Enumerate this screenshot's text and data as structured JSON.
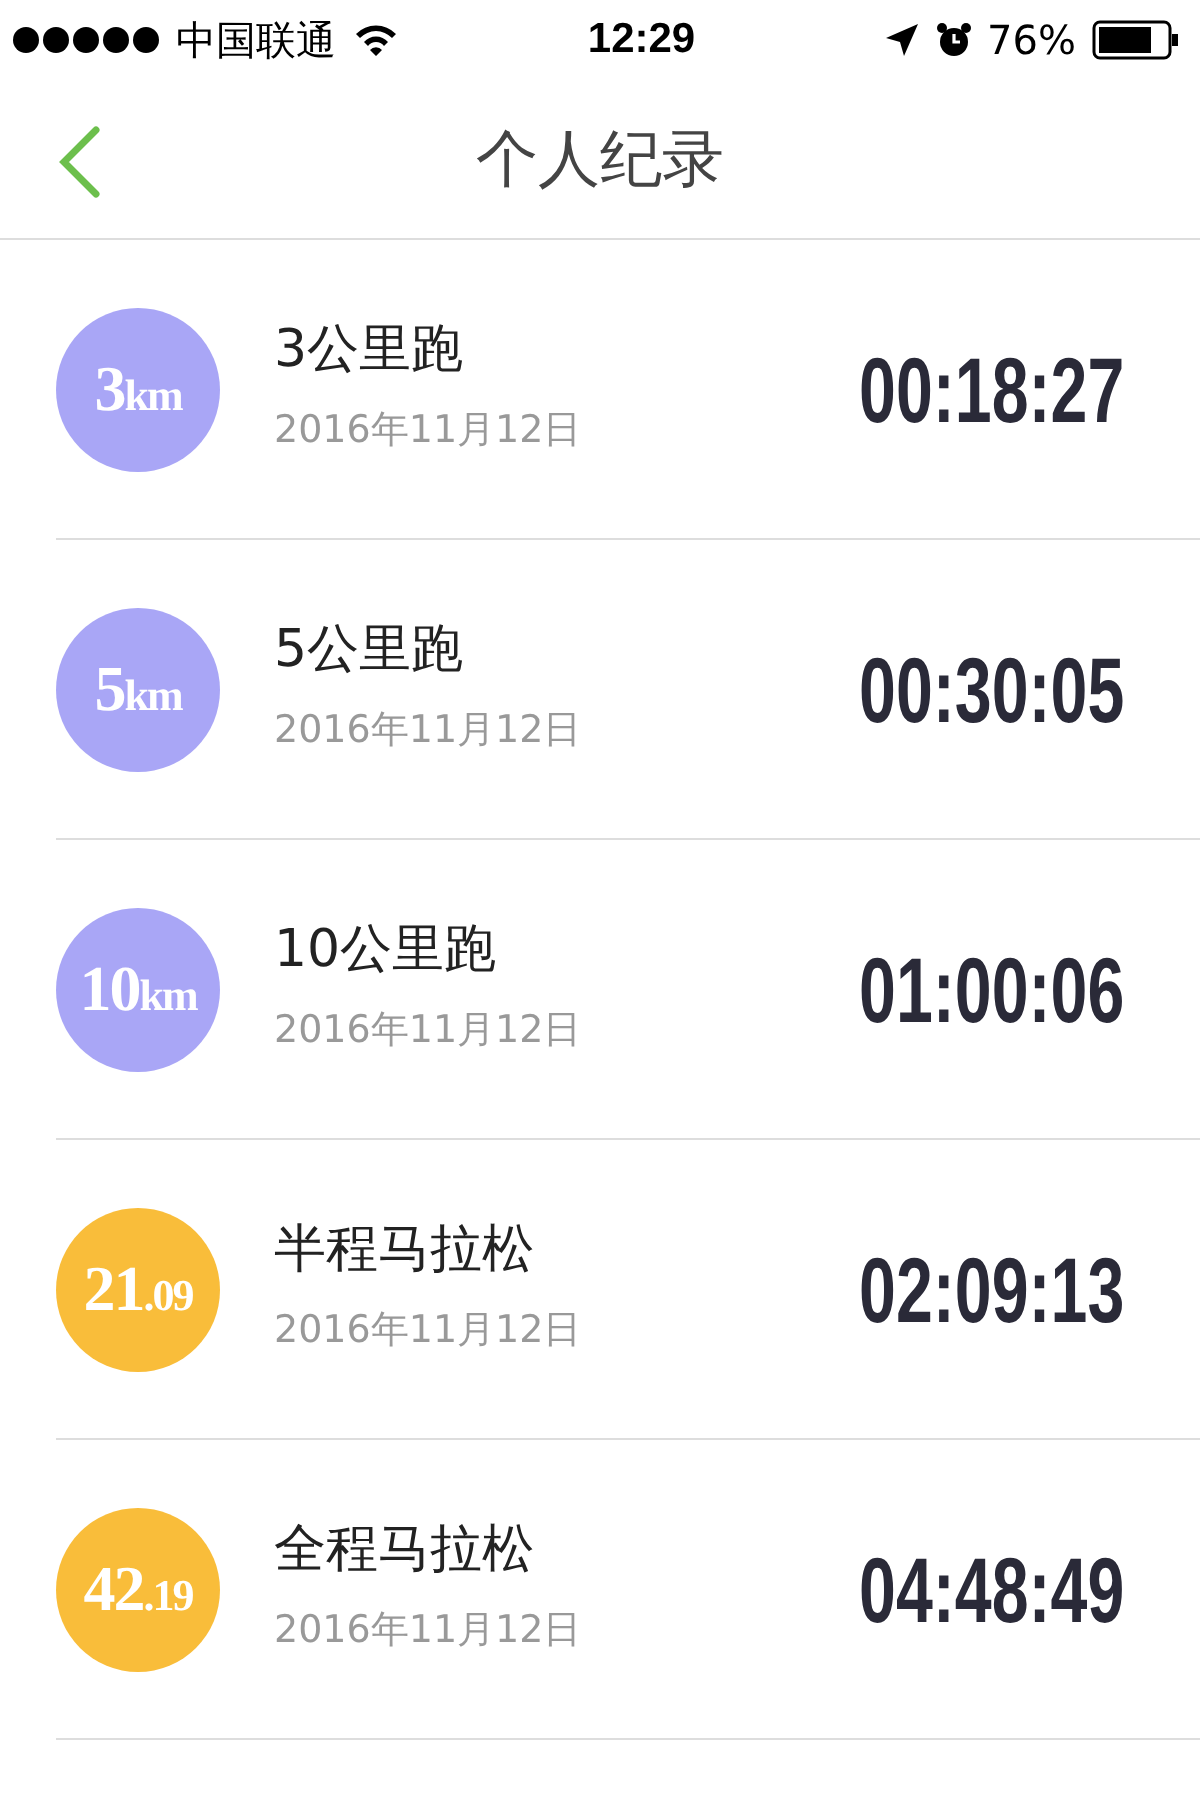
{
  "status_bar": {
    "carrier": "中国联通",
    "time": "12:29",
    "battery": "76%"
  },
  "nav": {
    "title": "个人纪录"
  },
  "records": [
    {
      "badge_main": "3",
      "badge_sub": "km",
      "color": "#a9a6f6",
      "name": "3公里跑",
      "date": "2016年11月12日",
      "time": "00:18:27"
    },
    {
      "badge_main": "5",
      "badge_sub": "km",
      "color": "#a9a6f6",
      "name": "5公里跑",
      "date": "2016年11月12日",
      "time": "00:30:05"
    },
    {
      "badge_main": "10",
      "badge_sub": "km",
      "color": "#a9a6f6",
      "name": "10公里跑",
      "date": "2016年11月12日",
      "time": "01:00:06"
    },
    {
      "badge_main": "21",
      "badge_sub": ".09",
      "color": "#f9bd3a",
      "name": "半程马拉松",
      "date": "2016年11月12日",
      "time": "02:09:13"
    },
    {
      "badge_main": "42",
      "badge_sub": ".19",
      "color": "#f9bd3a",
      "name": "全程马拉松",
      "date": "2016年11月12日",
      "time": "04:48:49"
    }
  ]
}
